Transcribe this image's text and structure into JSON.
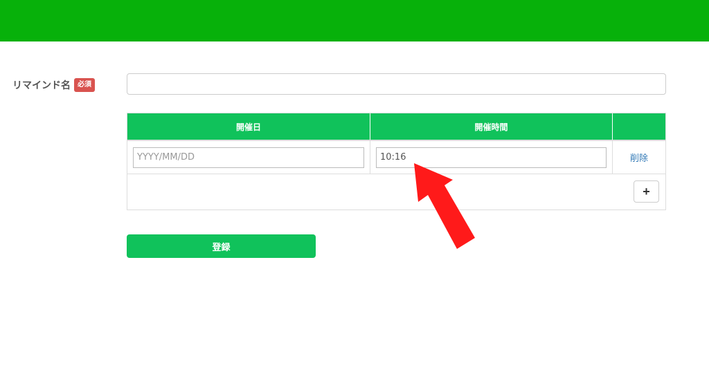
{
  "colors": {
    "top_bar": "#07b10a",
    "accent": "#10c25b",
    "required_badge": "#d9534f",
    "link": "#337ab7",
    "annotation_arrow": "#ff1a1a"
  },
  "form": {
    "name_label": "リマインド名",
    "required_badge": "必須",
    "name_value": ""
  },
  "table": {
    "headers": [
      "開催日",
      "開催時間",
      ""
    ],
    "rows": [
      {
        "date_placeholder": "YYYY/MM/DD",
        "date_value": "",
        "time_value": "10:16",
        "delete_label": "削除"
      }
    ],
    "add_label": "+"
  },
  "submit_label": "登録",
  "annotation": {
    "icon": "arrow-up-left-icon"
  }
}
